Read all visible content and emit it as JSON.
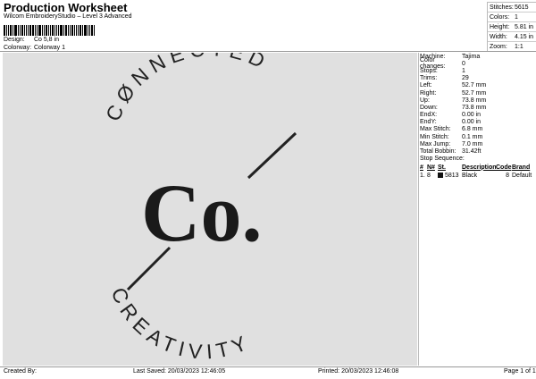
{
  "header": {
    "title": "Production Worksheet",
    "subtitle": "Wilcom EmbroideryStudio – Level 3 Advanced",
    "design_label": "Design:",
    "design_value": "Co 5,8 in",
    "colorway_label": "Colorway:",
    "colorway_value": "Colorway 1"
  },
  "summary": [
    {
      "k": "Stitches:",
      "v": "5615"
    },
    {
      "k": "Colors:",
      "v": "1"
    },
    {
      "k": "Height:",
      "v": "5.81 in"
    },
    {
      "k": "Width:",
      "v": "4.15 in"
    },
    {
      "k": "Zoom:",
      "v": "1:1"
    }
  ],
  "stats": [
    {
      "k": "Machine:",
      "v": "Tajima"
    },
    {
      "k": "Color changes:",
      "v": "0"
    },
    {
      "k": "Stops:",
      "v": "1"
    },
    {
      "k": "Trims:",
      "v": "29"
    },
    {
      "k": "Left:",
      "v": "52.7 mm"
    },
    {
      "k": "Right:",
      "v": "52.7 mm"
    },
    {
      "k": "Up:",
      "v": "73.8 mm"
    },
    {
      "k": "Down:",
      "v": "73.8 mm"
    },
    {
      "k": "EndX:",
      "v": "0.00 in"
    },
    {
      "k": "EndY:",
      "v": "0.00 in"
    },
    {
      "k": "Max Stitch:",
      "v": "6.8 mm"
    },
    {
      "k": "Min Stitch:",
      "v": "0.1 mm"
    },
    {
      "k": "Max Jump:",
      "v": "7.0 mm"
    },
    {
      "k": "Total Bobbin:",
      "v": "31.42ft"
    }
  ],
  "stop_sequence": {
    "title": "Stop Sequence:",
    "headers": [
      "#",
      "N#",
      "St.",
      "Description",
      "Code",
      "Brand"
    ],
    "rows": [
      {
        "num": "1.",
        "n": "8",
        "st": "5813",
        "desc": "Black",
        "code": "8",
        "brand": "Default",
        "color": "#111111"
      }
    ]
  },
  "design": {
    "top_arc_text": "CØNNECTED",
    "bottom_arc_text": "CREATIVITY",
    "center_text": "Co."
  },
  "footer": {
    "created_by": "Created By:",
    "last_saved": "Last Saved: 20/03/2023 12:46:05",
    "printed": "Printed: 20/03/2023 12:46:08",
    "page": "Page 1 of 1"
  }
}
